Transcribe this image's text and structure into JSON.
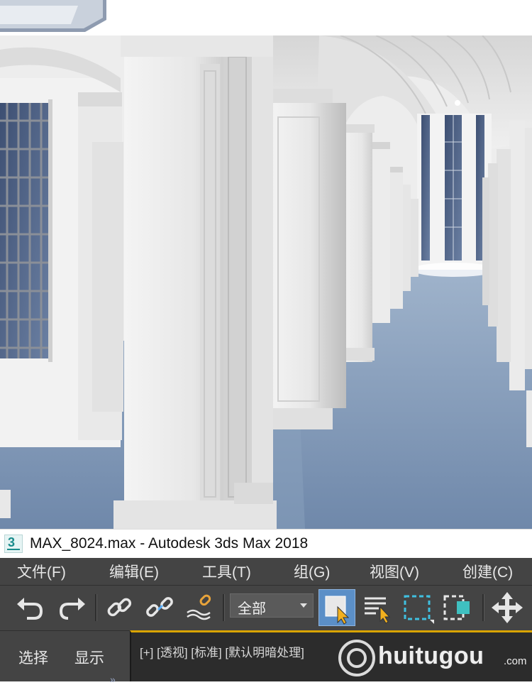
{
  "window": {
    "title": "MAX_8024.max - Autodesk 3ds Max 2018",
    "app_icon_text": "3"
  },
  "menu": {
    "items": [
      "文件(F)",
      "编辑(E)",
      "工具(T)",
      "组(G)",
      "视图(V)",
      "创建(C)"
    ]
  },
  "toolbar": {
    "buttons": [
      {
        "name": "undo",
        "icon": "undo-icon"
      },
      {
        "name": "redo",
        "icon": "redo-icon"
      },
      {
        "name": "link",
        "icon": "link-icon"
      },
      {
        "name": "unlink",
        "icon": "unlink-icon"
      },
      {
        "name": "bind-to-space-warp",
        "icon": "space-warp-icon"
      },
      {
        "name": "select-object",
        "icon": "select-object-icon",
        "active": true
      },
      {
        "name": "select-by-name",
        "icon": "select-by-name-icon"
      },
      {
        "name": "rectangular-selection-region",
        "icon": "rect-selection-icon"
      },
      {
        "name": "window-crossing",
        "icon": "window-crossing-icon"
      },
      {
        "name": "select-and-move",
        "icon": "move-icon"
      }
    ],
    "selection_filter": "全部"
  },
  "scene_explorer": {
    "tabs": [
      "选择",
      "显示"
    ],
    "collapse_icon": "double-chevron-icon"
  },
  "viewport": {
    "label": "[+] [透视] [标准] [默认明暗处理]"
  },
  "watermark": {
    "text": "huitugou",
    "suffix": ".com"
  },
  "colors": {
    "menu_bg": "#444444",
    "viewport_border": "#d9a400",
    "active_button": "#5b8fc7",
    "floor": "#7c95b5"
  }
}
